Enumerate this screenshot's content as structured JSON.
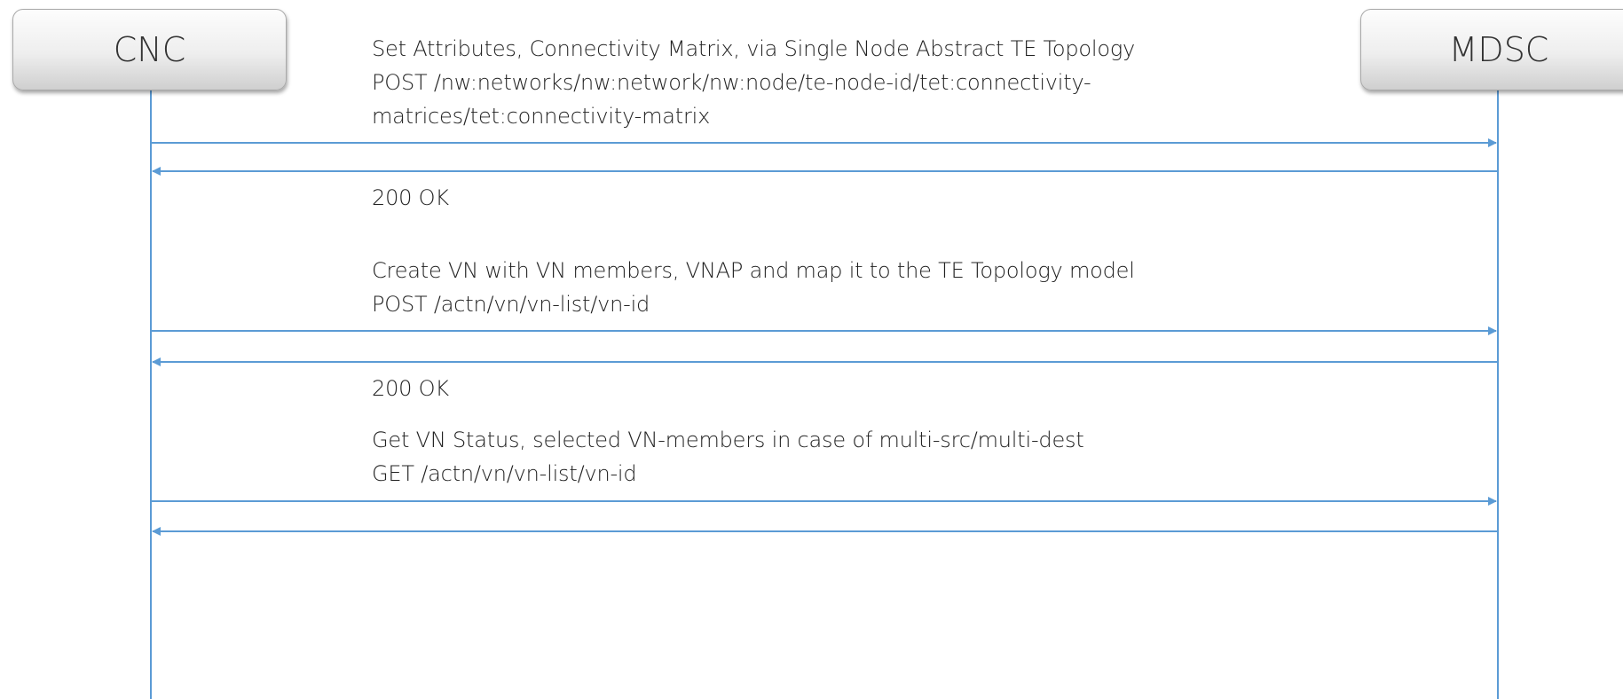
{
  "actors": {
    "left": "CNC",
    "right": "MDSC"
  },
  "messages": [
    {
      "lines": [
        "Set Attributes, Connectivity Matrix, via Single Node Abstract TE Topology",
        "POST /nw:networks/nw:network/nw:node/te-node-id/tet:connectivity-",
        "matrices/tet:connectivity-matrix"
      ],
      "direction": "right"
    },
    {
      "lines": [
        "200 OK"
      ],
      "direction": "left"
    },
    {
      "lines": [
        "Create VN with VN members, VNAP and map it to the TE Topology model",
        "POST /actn/vn/vn-list/vn-id"
      ],
      "direction": "right"
    },
    {
      "lines": [
        "200 OK"
      ],
      "direction": "left"
    },
    {
      "lines": [
        "Get VN Status, selected VN-members in case of multi-src/multi-dest",
        "GET /actn/vn/vn-list/vn-id"
      ],
      "direction": "right"
    },
    {
      "lines": [],
      "direction": "left"
    }
  ],
  "colors": {
    "line": "#5b9bd5",
    "text": "#222222"
  }
}
